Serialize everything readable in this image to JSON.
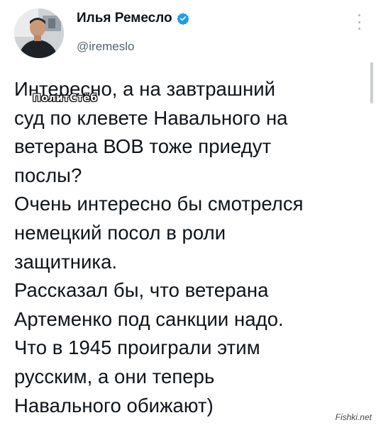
{
  "tweet": {
    "author_name": "Илья Ремесло",
    "author_handle": "@iremeslo",
    "verified_badge_color": "#1d9bf0",
    "lines": [
      "Интересно, а на завтрашний",
      "суд по клевете Навального на",
      "ветерана ВОВ тоже приедут",
      "послы?",
      "Очень интересно бы смотрелся",
      "немецкий посол в роли",
      "защитника.",
      "Рассказал бы, что ветерана",
      "Артеменко под санкции надо.",
      "Что в 1945 проиграли этим",
      "русским, а они теперь",
      "Навального обижают)"
    ]
  },
  "watermark": {
    "text": "ПолитСтёб"
  },
  "site_credit": {
    "text": "Fishki.net"
  },
  "icons": {
    "more": "more-vertical-icon",
    "verified": "verified-badge-icon"
  }
}
